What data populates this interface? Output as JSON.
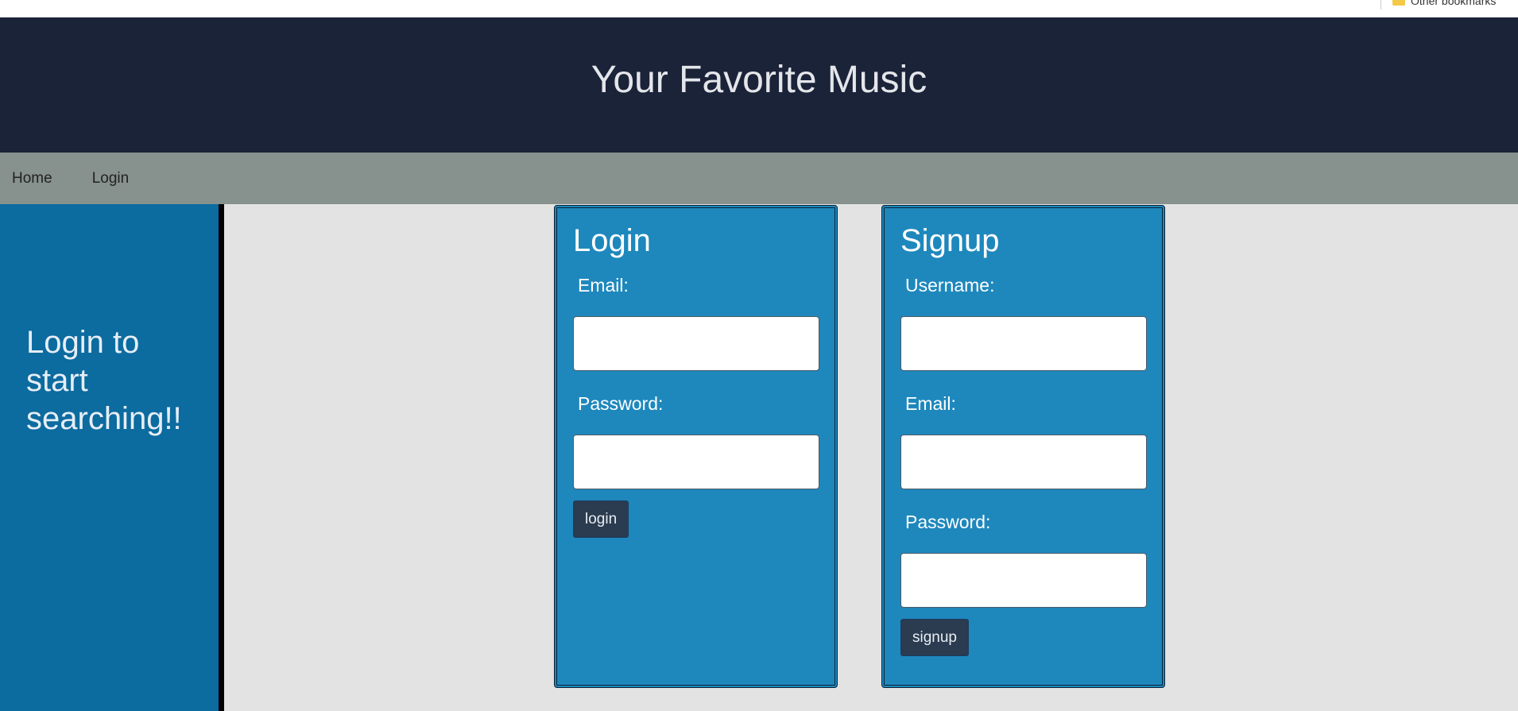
{
  "browser": {
    "bookmarks_folder_label": "Other bookmarks"
  },
  "header": {
    "title": "Your Favorite Music"
  },
  "nav": {
    "items": [
      {
        "label": "Home"
      },
      {
        "label": "Login"
      }
    ]
  },
  "sidebar": {
    "message": "Login to start searching!!"
  },
  "login_form": {
    "title": "Login",
    "email_label": "Email:",
    "email_value": "",
    "password_label": "Password:",
    "password_value": "",
    "submit_label": "login"
  },
  "signup_form": {
    "title": "Signup",
    "username_label": "Username:",
    "username_value": "",
    "email_label": "Email:",
    "email_value": "",
    "password_label": "Password:",
    "password_value": "",
    "submit_label": "signup"
  },
  "icons": {
    "bookmarks_folder": "folder-icon"
  },
  "colors": {
    "header_bg": "#1b2339",
    "header_text": "#e4e6ea",
    "nav_bg": "#87918d",
    "sidebar_bg": "#0c6b9f",
    "main_bg": "#e3e3e3",
    "panel_bg": "#1e88bd",
    "button_bg": "#2b3b50"
  }
}
